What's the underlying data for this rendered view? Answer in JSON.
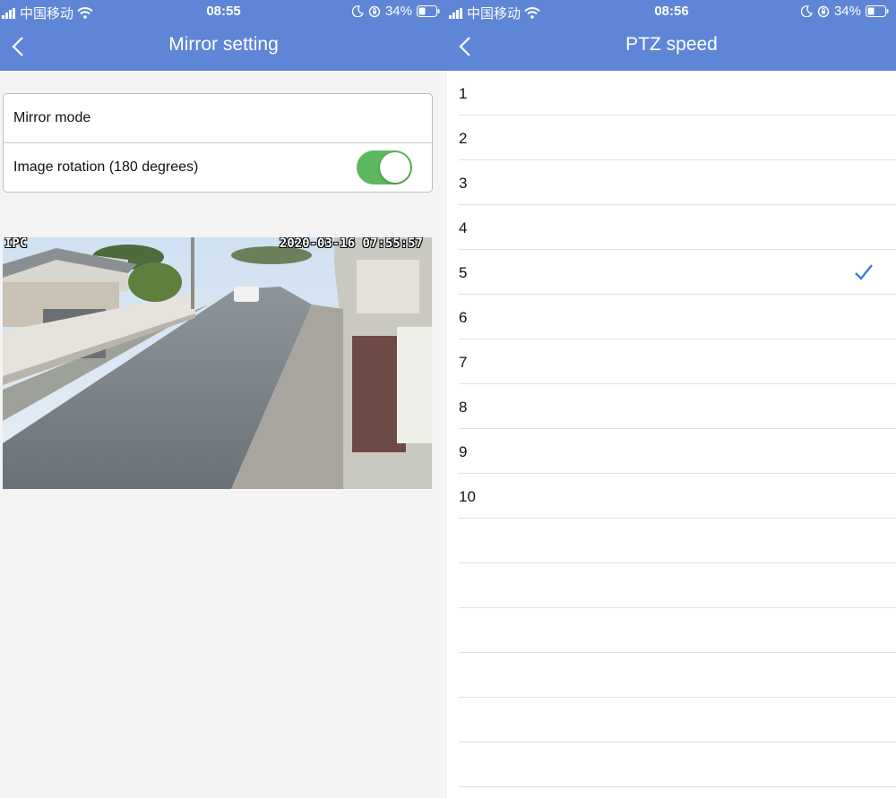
{
  "colors": {
    "header": "#5f86d6",
    "toggle_on": "#5cb85c",
    "check": "#3b7ddd"
  },
  "left_screen": {
    "status_bar": {
      "carrier": "中国移动",
      "time": "08:55",
      "battery": "34%"
    },
    "title": "Mirror setting",
    "settings": [
      {
        "label": "Mirror mode"
      },
      {
        "label": "Image rotation (180 degrees)",
        "toggle_on": true
      }
    ],
    "camera_preview": {
      "osd_label": "IPC",
      "osd_timestamp": "2020-03-16 07:55:57"
    }
  },
  "right_screen": {
    "status_bar": {
      "carrier": "中国移动",
      "time": "08:56",
      "battery": "34%"
    },
    "title": "PTZ speed",
    "speed_options": [
      "1",
      "2",
      "3",
      "4",
      "5",
      "6",
      "7",
      "8",
      "9",
      "10"
    ],
    "selected": "5",
    "empty_rows": 6
  }
}
